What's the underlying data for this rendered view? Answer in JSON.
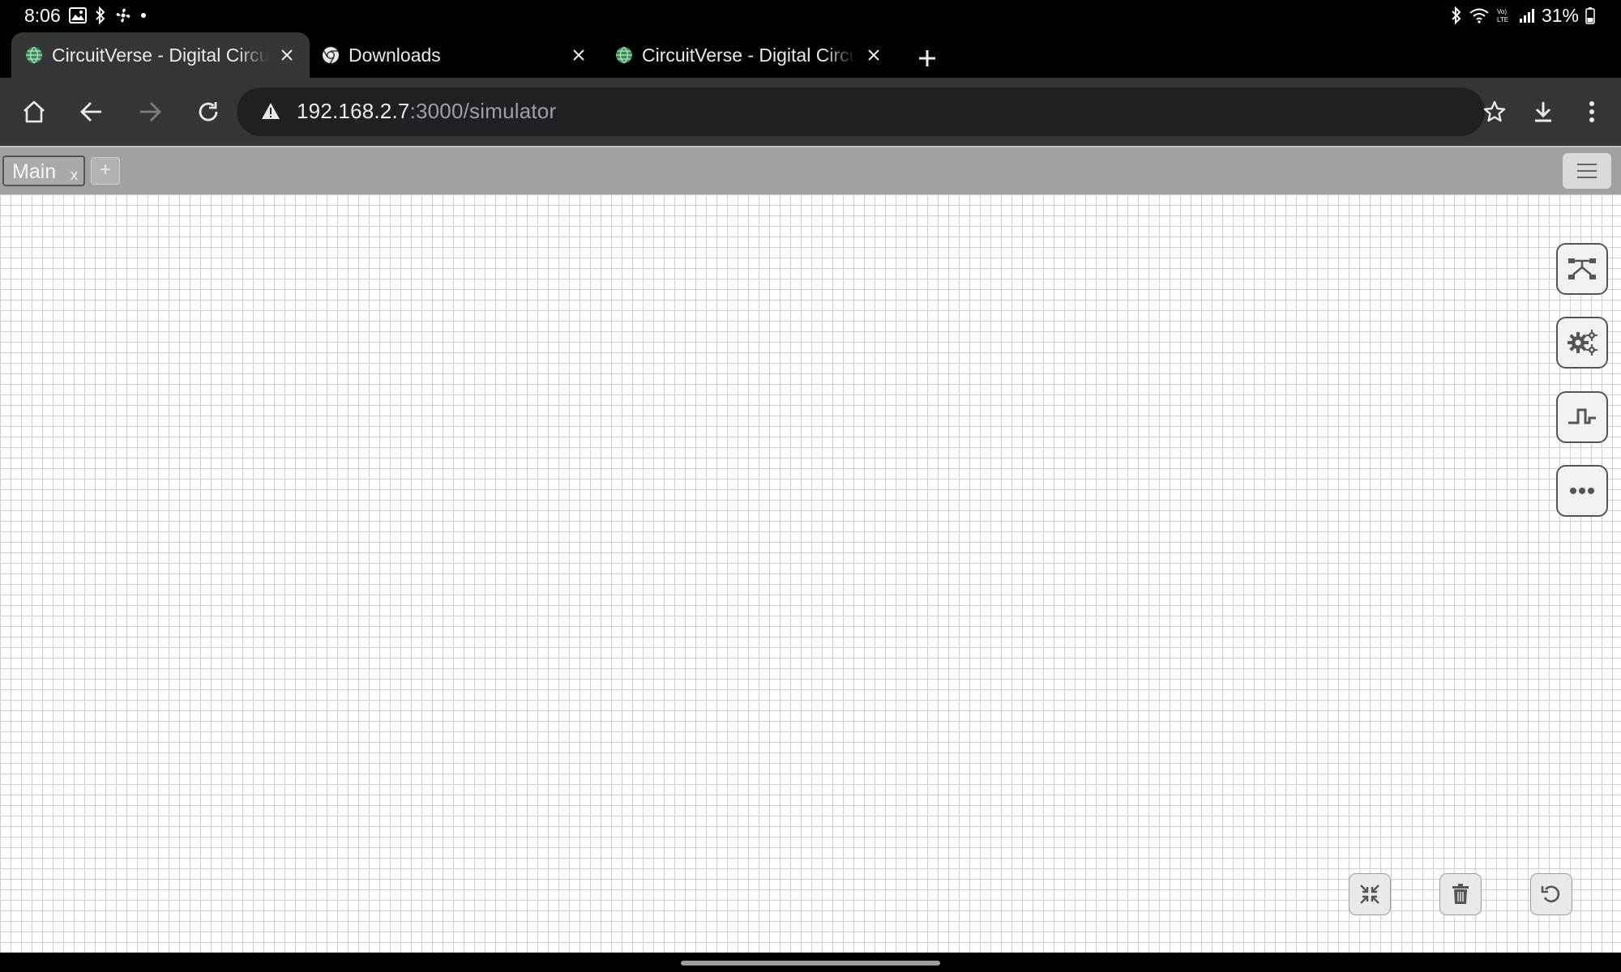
{
  "status_bar": {
    "time": "8:06",
    "battery": "31%",
    "left_icons": [
      "gallery-icon",
      "bluetooth-icon",
      "fan-icon",
      "dot-icon"
    ],
    "right_icons": [
      "bluetooth-icon",
      "wifi-icon",
      "volte-icon",
      "signal-icon",
      "battery-icon"
    ]
  },
  "browser": {
    "tabs": [
      {
        "title": "CircuitVerse - Digital Circuit Simulator",
        "favicon": "globe-icon",
        "active": true
      },
      {
        "title": "Downloads",
        "favicon": "chrome-icon",
        "active": false
      },
      {
        "title": "CircuitVerse - Digital Circuit Simulator",
        "favicon": "globe-icon",
        "active": false
      }
    ],
    "url_host": "192.168.2.7",
    "url_path": ":3000/simulator",
    "security": "not-secure-warning-icon"
  },
  "app": {
    "circuit_tab": {
      "name": "Main",
      "close": "x"
    },
    "add_circuit": "+",
    "side_buttons": [
      "circuit-elements-icon",
      "properties-gear-icon",
      "timing-diagram-icon",
      "more-options-icon"
    ],
    "bottom_buttons": [
      "fit-to-screen-icon",
      "delete-icon",
      "undo-icon"
    ]
  },
  "colors": {
    "chrome_tab_active": "#35363a",
    "omnibox": "#202124",
    "appbar": "#a0a0a0",
    "grid_line": "#cfcfcf",
    "favicon_green": "#3d8f5a"
  }
}
